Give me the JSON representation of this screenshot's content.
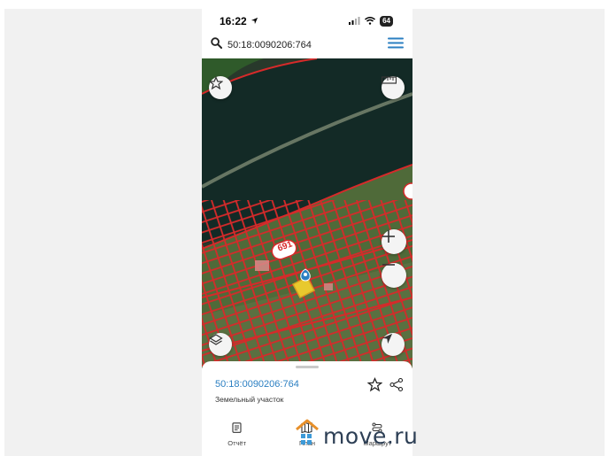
{
  "status_bar": {
    "time": "16:22",
    "battery": "64"
  },
  "search": {
    "value": "50:18:0090206:764"
  },
  "map": {
    "parcel_label": "691"
  },
  "sheet": {
    "parcel_id": "50:18:0090206:764",
    "parcel_type": "Земельный участок"
  },
  "tabs": [
    {
      "label": "Отчёт",
      "icon": "report-icon"
    },
    {
      "label": "План",
      "icon": "map-plan-icon"
    },
    {
      "label": "Маршрут",
      "icon": "route-icon"
    }
  ],
  "watermark": {
    "text": "move.ru"
  },
  "colors": {
    "accent": "#2b7fc2",
    "parcel_border": "#d62a2a",
    "parcel_highlight": "#e8c92e"
  }
}
